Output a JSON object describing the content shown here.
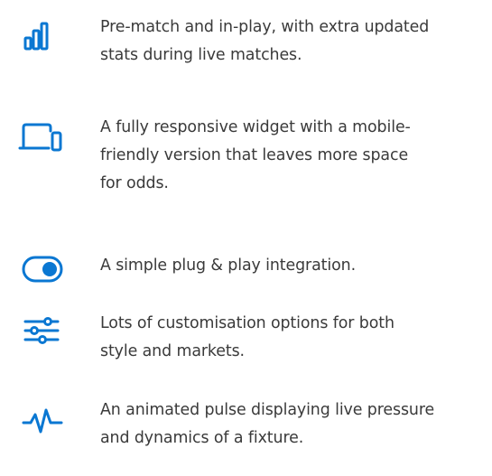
{
  "colors": {
    "accent": "#0a77d2",
    "text": "#3a3a3a",
    "background": "#ffffff"
  },
  "features": [
    {
      "icon": "bar-chart-icon",
      "lines": [
        "Pre-match and in-play, with extra updated",
        "stats during live matches."
      ]
    },
    {
      "icon": "responsive-devices-icon",
      "lines": [
        "A fully responsive widget with a mobile-",
        "friendly version that leaves more space",
        "for odds."
      ]
    },
    {
      "icon": "toggle-switch-icon",
      "lines": [
        "A simple plug & play integration."
      ]
    },
    {
      "icon": "sliders-icon",
      "lines": [
        "Lots of customisation options for both",
        "style and markets."
      ]
    },
    {
      "icon": "pulse-icon",
      "lines": [
        "An animated pulse displaying live pressure",
        "and dynamics of a fixture."
      ]
    }
  ]
}
